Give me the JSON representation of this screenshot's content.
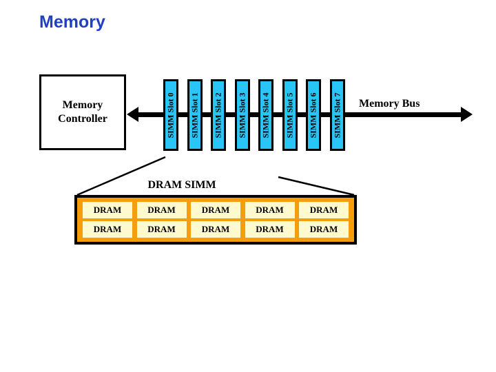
{
  "slide": {
    "title": "Memory",
    "title_color": "#2040c0",
    "background": "#ffffff"
  },
  "controller": {
    "label": "Memory\nController",
    "border_color": "#000000",
    "fill_color": "#ffffff"
  },
  "bus": {
    "label": "Memory Bus",
    "color": "#000000",
    "left_arrow": "arrow-left-icon",
    "right_arrow": "arrow-right-icon"
  },
  "slots": {
    "fill_color": "#29c5f6",
    "border_color": "#000000",
    "items": [
      {
        "label": "SIMM Slot 0"
      },
      {
        "label": "SIMM Slot 1"
      },
      {
        "label": "SIMM Slot 2"
      },
      {
        "label": "SIMM Slot 3"
      },
      {
        "label": "SIMM Slot 4"
      },
      {
        "label": "SIMM Slot 5"
      },
      {
        "label": "SIMM Slot 6"
      },
      {
        "label": "SIMM Slot 7"
      }
    ]
  },
  "dram_simm": {
    "label": "DRAM SIMM",
    "board_color": "#f59d0b",
    "chip_color": "#fffacd",
    "border_color": "#000000",
    "rows": [
      [
        {
          "label": "DRAM"
        },
        {
          "label": "DRAM"
        },
        {
          "label": "DRAM"
        },
        {
          "label": "DRAM"
        },
        {
          "label": "DRAM"
        }
      ],
      [
        {
          "label": "DRAM"
        },
        {
          "label": "DRAM"
        },
        {
          "label": "DRAM"
        },
        {
          "label": "DRAM"
        },
        {
          "label": "DRAM"
        }
      ]
    ]
  }
}
